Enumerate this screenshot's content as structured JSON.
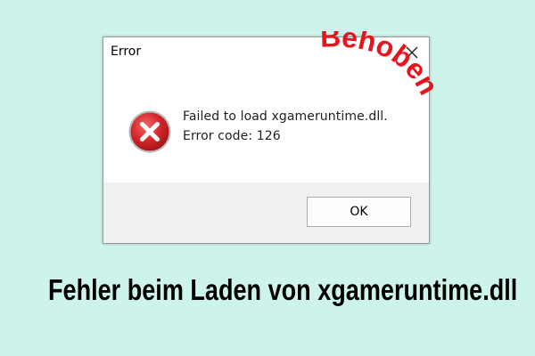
{
  "dialog": {
    "title": "Error",
    "message_line1": "Failed to load xgameruntime.dll.",
    "message_line2": "Error code: 126",
    "ok_label": "OK"
  },
  "stamp": {
    "text": "Behoben",
    "color": "#e8141b"
  },
  "headline": "Fehler beim Laden von xgameruntime.dll",
  "colors": {
    "background": "#cdf4ea",
    "error_icon": "#c8262d",
    "footer": "#f0f0f0"
  },
  "icons": {
    "close": "close-icon",
    "error": "error-icon"
  }
}
